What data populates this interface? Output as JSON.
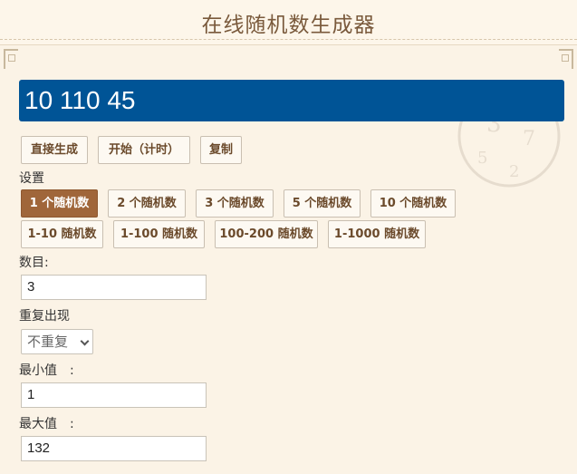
{
  "header": {
    "title": "在线随机数生成器"
  },
  "result": {
    "value": "10 110 45"
  },
  "actions": [
    {
      "label": "直接生成"
    },
    {
      "label": "开始（计时）"
    },
    {
      "label": "复制"
    }
  ],
  "settings": {
    "title": "设置",
    "presets_row1": [
      "1 个随机数",
      "2 个随机数",
      "3 个随机数",
      "5 个随机数",
      "10 个随机数"
    ],
    "presets_row2": [
      "1-10 随机数",
      "1-100 随机数",
      "100-200 随机数",
      "1-1000 随机数"
    ],
    "count_label": "数目:",
    "count_value": "3",
    "repeat_label": "重复出现",
    "repeat_selected": "不重复",
    "min_label": "最小值　:",
    "min_value": "1",
    "max_label": "最大值　:",
    "max_value": "132"
  },
  "colors": {
    "display_bg": "#005496",
    "active_button": "#a0663a",
    "page_bg": "#fbf3e6"
  }
}
